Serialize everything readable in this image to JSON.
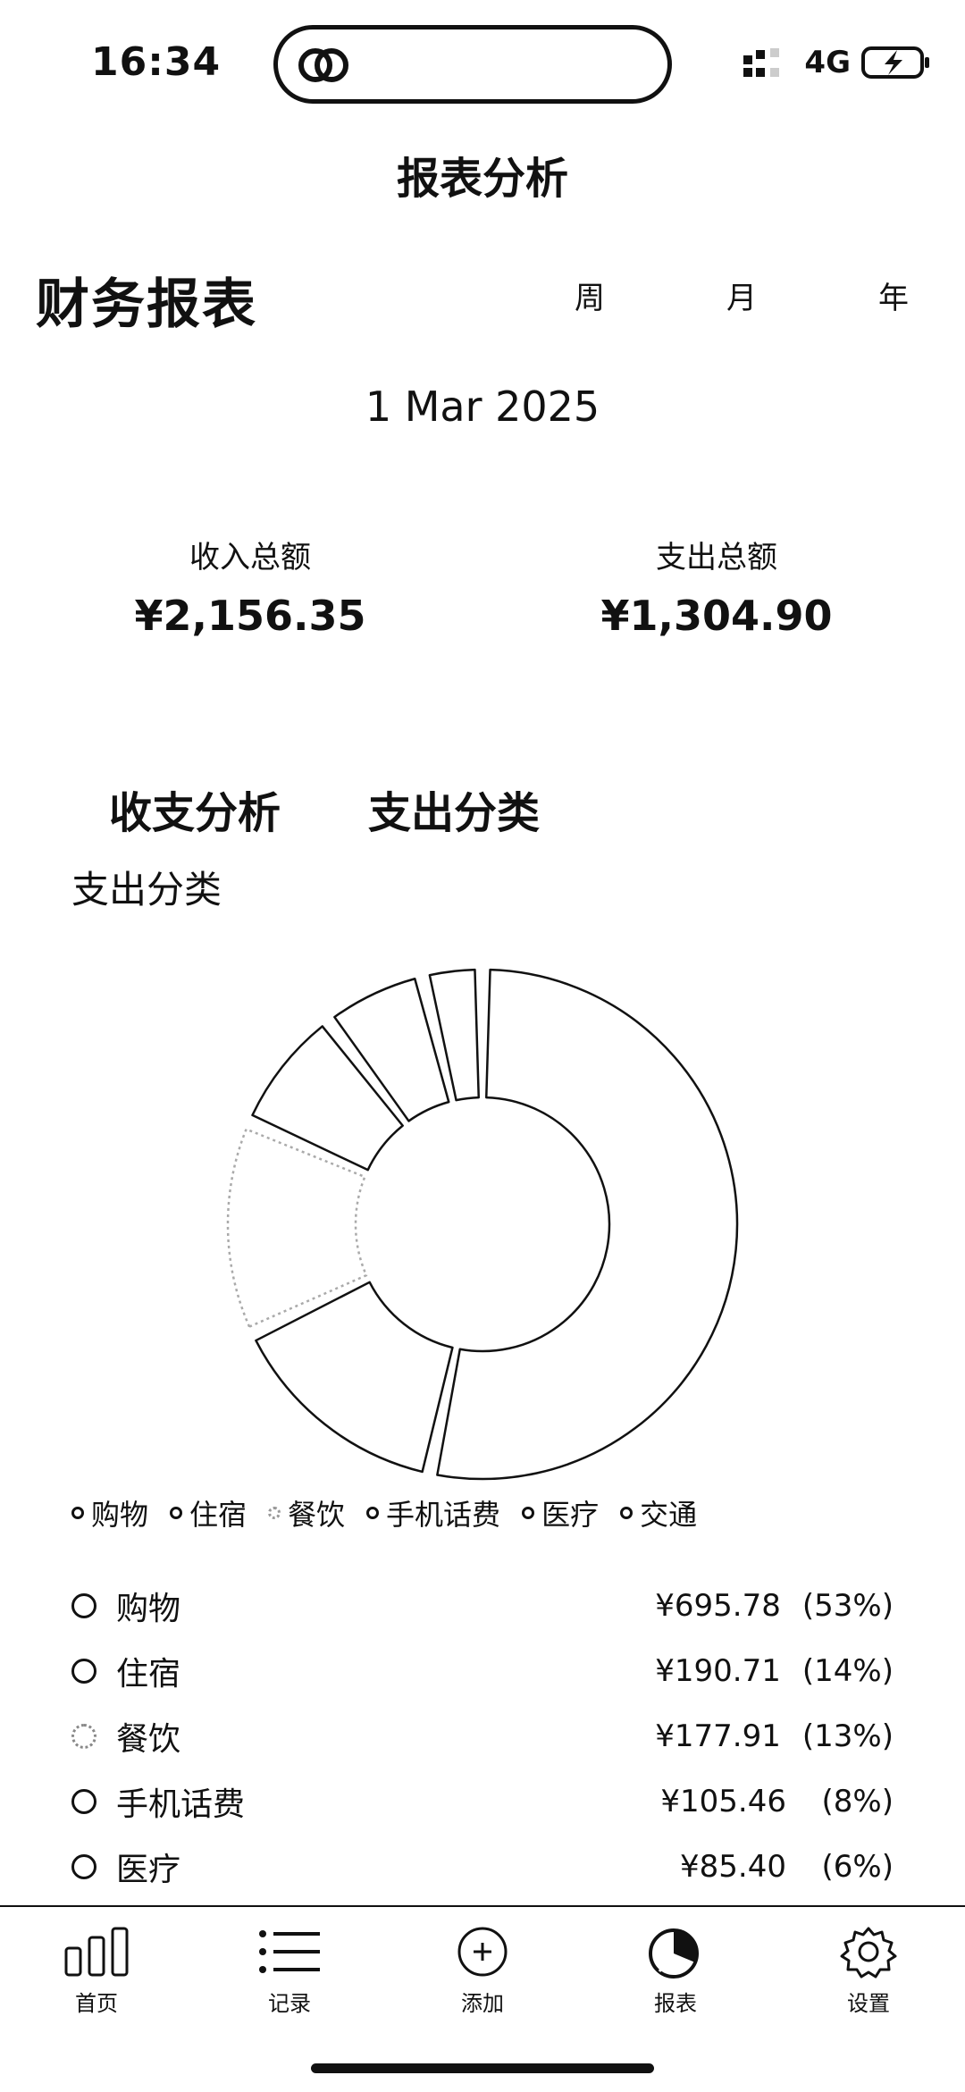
{
  "status": {
    "time": "16:34",
    "network": "4G"
  },
  "header": {
    "title": "报表分析"
  },
  "page": {
    "title": "财务报表",
    "periods": [
      "周",
      "月",
      "年"
    ],
    "date": "1 Mar 2025"
  },
  "summary": {
    "income_label": "收入总额",
    "income_value": "¥2,156.35",
    "expense_label": "支出总额",
    "expense_value": "¥1,304.90"
  },
  "view_tabs": [
    "收支分析",
    "支出分类"
  ],
  "section_label": "支出分类",
  "legend": [
    "购物",
    "住宿",
    "餐饮",
    "手机话费",
    "医疗",
    "交通"
  ],
  "chart_data": {
    "type": "pie",
    "categories": [
      "购物",
      "住宿",
      "餐饮",
      "手机话费",
      "医疗",
      "交通"
    ],
    "values": [
      695.78,
      190.71,
      177.91,
      105.46,
      85.4,
      49.64
    ]
  },
  "rows": [
    {
      "name": "购物",
      "amount": "¥695.78",
      "pct": "(53%)"
    },
    {
      "name": "住宿",
      "amount": "¥190.71",
      "pct": "(14%)"
    },
    {
      "name": "餐饮",
      "amount": "¥177.91",
      "pct": "(13%)"
    },
    {
      "name": "手机话费",
      "amount": "¥105.46",
      "pct": "(8%)"
    },
    {
      "name": "医疗",
      "amount": "¥85.40",
      "pct": "(6%)"
    }
  ],
  "tabbar": [
    "首页",
    "记录",
    "添加",
    "报表",
    "设置"
  ]
}
